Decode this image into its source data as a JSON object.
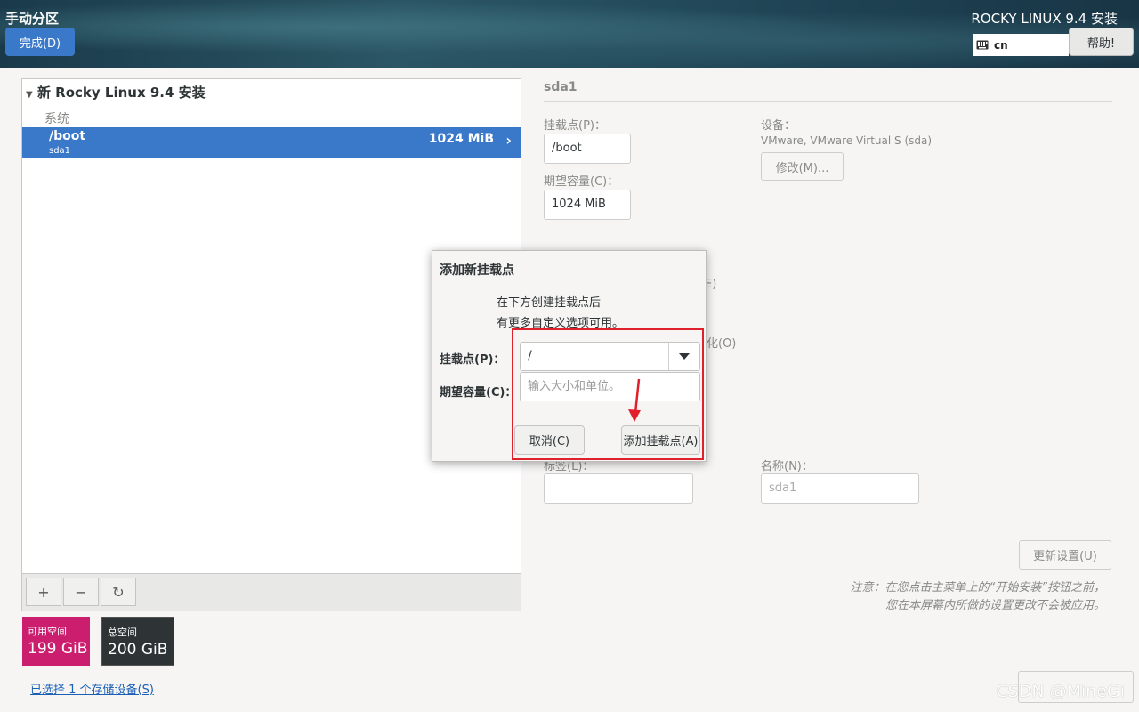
{
  "header": {
    "spoke_title": "手动分区",
    "done_label": "完成(D)",
    "distro_title": "ROCKY LINUX 9.4 安装",
    "keyboard_layout": "cn",
    "help_label": "帮助!"
  },
  "left": {
    "installation_title": "新 Rocky Linux 9.4 安装",
    "system_label": "系统",
    "partition": {
      "mount": "/boot",
      "device": "sda1",
      "size": "1024 MiB"
    },
    "toolbar": {
      "add": "+",
      "remove": "−",
      "refresh": "↻"
    },
    "available": {
      "label": "可用空间",
      "value": "199 GiB"
    },
    "total": {
      "label": "总空间",
      "value": "200 GiB"
    },
    "storage_link": "已选择 1 个存储设备(S)"
  },
  "right": {
    "title": "sda1",
    "mount_label": "挂载点(P)：",
    "mount_value": "/boot",
    "capacity_label": "期望容量(C)：",
    "capacity_value": "1024 MiB",
    "device_label": "设备：",
    "device_value": "VMware, VMware Virtual S (sda)",
    "modify_label": "修改(M)...",
    "partial_e": "E)",
    "partial_o": "化(O)",
    "tag_label": "标签(L)：",
    "name_label": "名称(N)：",
    "name_value": "sda1",
    "update_label": "更新设置(U)",
    "note_line1": "注意：在您点击主菜单上的“开始安装”按钮之前，",
    "note_line2": "您在本屏幕内所做的设置更改不会被应用。"
  },
  "dialog": {
    "title": "添加新挂载点",
    "desc_line1": "在下方创建挂载点后",
    "desc_line2": "有更多自定义选项可用。",
    "mount_label": "挂载点(P)：",
    "mount_value": "/",
    "capacity_label": "期望容量(C)：",
    "capacity_placeholder": "输入大小和单位。",
    "cancel_label": "取消(C)",
    "add_label": "添加挂载点(A)"
  },
  "watermark": "CSDN @MineGi",
  "colors": {
    "accent": "#3a78c9",
    "available": "#cc1e6e",
    "total": "#2e3436",
    "highlight": "#e0202a"
  },
  "icons": [
    "keyboard-icon",
    "expander-triangle-icon",
    "chevron-right-icon",
    "dropdown-arrow-icon",
    "annotation-arrow-icon"
  ]
}
